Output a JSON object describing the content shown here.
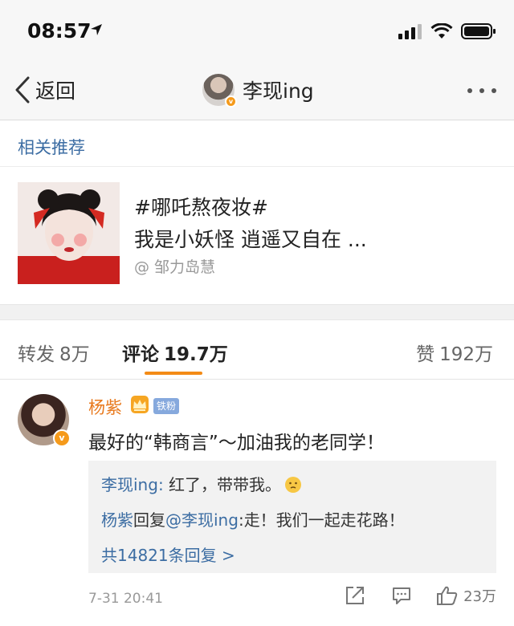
{
  "status_bar": {
    "time": "08:57",
    "location_icon": "location-arrow-icon",
    "signal_icon": "cellular-signal-icon",
    "wifi_icon": "wifi-icon",
    "battery_icon": "battery-icon"
  },
  "nav": {
    "back_label": "返回",
    "title": "李现ing",
    "more_icon": "more-dots-icon"
  },
  "related": {
    "header": "相关推荐",
    "card": {
      "line1": "#哪吒熬夜妆#",
      "line2": "我是小妖怪 逍遥又自在 ...",
      "author": "@ 邹力岛慧"
    }
  },
  "tabs": {
    "repost": {
      "label": "转发",
      "count": "8万"
    },
    "comment": {
      "label": "评论",
      "count": "19.7万"
    },
    "like": {
      "label": "赞",
      "count": "192万"
    }
  },
  "comment": {
    "name": "杨紫",
    "badge": "铁粉",
    "text": "最好的“韩商言”～加油我的老同学！",
    "replies": [
      {
        "author": "李现ing",
        "sep": ": ",
        "text": "红了，带带我。"
      },
      {
        "author": "杨紫",
        "verb": "回复",
        "mention": "@李现ing",
        "sep": ":",
        "text": "走！我们一起走花路！"
      }
    ],
    "more_replies": "共14821条回复 >",
    "time": "7-31 20:41",
    "like_count": "23万"
  },
  "colors": {
    "link": "#3c6da3",
    "name_orange": "#e8791d",
    "accent_underline": "#f38b16",
    "badge_blue": "#86a9dd",
    "verified": "#f59a1b"
  }
}
